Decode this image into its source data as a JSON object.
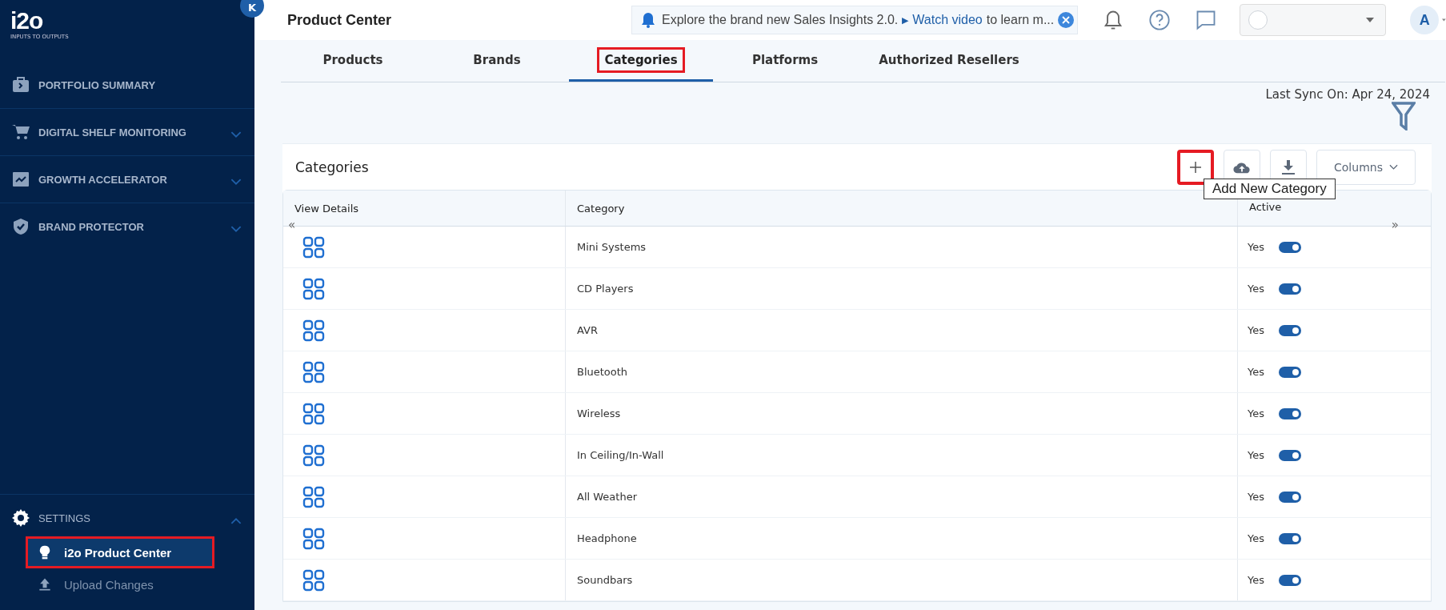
{
  "sidebar": {
    "logo": "i2o",
    "tagline": "INPUTS TO OUTPUTS",
    "collapse": "K",
    "items": [
      {
        "kind": "briefcase",
        "label": "PORTFOLIO SUMMARY",
        "expandable": false
      },
      {
        "kind": "cart",
        "label": "DIGITAL SHELF MONITORING",
        "expandable": true
      },
      {
        "kind": "chart",
        "label": "GROWTH ACCELERATOR",
        "expandable": true
      },
      {
        "kind": "shield",
        "label": "BRAND PROTECTOR",
        "expandable": true
      }
    ],
    "settings": {
      "label": "SETTINGS",
      "expanded": true,
      "children": [
        {
          "kind": "bulb",
          "label": "i2o Product Center",
          "selected": true,
          "highlighted": true
        },
        {
          "kind": "upload",
          "label": "Upload Changes",
          "selected": false,
          "highlighted": false
        }
      ]
    }
  },
  "header": {
    "title": "Product Center",
    "banner": {
      "text": "Explore the brand new Sales Insights 2.0.",
      "play": "▶",
      "link": "Watch video",
      "rest": "to learn m..."
    },
    "avatar": "A"
  },
  "tabs": [
    {
      "label": "Products",
      "selected": false,
      "highlighted": false
    },
    {
      "label": "Brands",
      "selected": false,
      "highlighted": false
    },
    {
      "label": "Categories",
      "selected": true,
      "highlighted": true
    },
    {
      "label": "Platforms",
      "selected": false,
      "highlighted": false
    },
    {
      "label": "Authorized Resellers",
      "selected": false,
      "highlighted": false
    }
  ],
  "last_sync": "Last Sync On: Apr 24, 2024",
  "card": {
    "title": "Categories",
    "columns_button": "Columns",
    "tooltip": "Add New Category",
    "add_highlighted": true
  },
  "table": {
    "columns": [
      "View Details",
      "Category",
      "Active"
    ],
    "scroll_left": "«",
    "scroll_right": "»",
    "rows": [
      {
        "category": "Mini Systems",
        "active": "Yes",
        "on": true
      },
      {
        "category": "CD Players",
        "active": "Yes",
        "on": true
      },
      {
        "category": "AVR",
        "active": "Yes",
        "on": true
      },
      {
        "category": "Bluetooth",
        "active": "Yes",
        "on": true
      },
      {
        "category": "Wireless",
        "active": "Yes",
        "on": true
      },
      {
        "category": "In Ceiling/In-Wall",
        "active": "Yes",
        "on": true
      },
      {
        "category": "All Weather",
        "active": "Yes",
        "on": true
      },
      {
        "category": "Headphone",
        "active": "Yes",
        "on": true
      },
      {
        "category": "Soundbars",
        "active": "Yes",
        "on": true
      }
    ]
  }
}
